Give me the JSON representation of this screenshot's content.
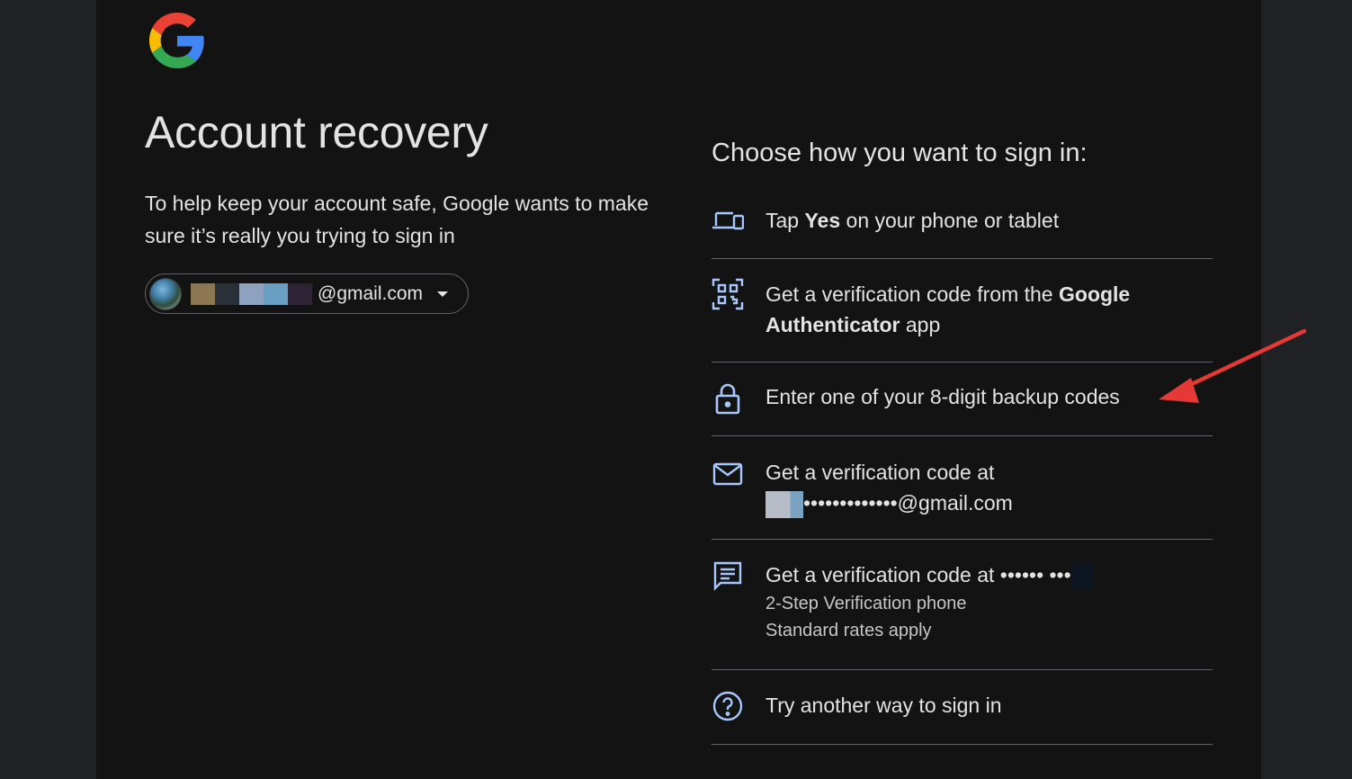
{
  "header": {
    "logo": "google-g-logo"
  },
  "left": {
    "title": "Account recovery",
    "subtitle": "To help keep your account safe, Google wants to make sure it’s really you trying to sign in",
    "account_email_suffix": "@gmail.com"
  },
  "right": {
    "choose_label": "Choose how you want to sign in:",
    "options": [
      {
        "icon": "devices-icon",
        "pre": "Tap ",
        "bold": "Yes",
        "post": " on your phone or tablet"
      },
      {
        "icon": "qr-code-icon",
        "pre": "Get a verification code from the ",
        "bold": "Google Authenticator",
        "post": " app"
      },
      {
        "icon": "lock-icon",
        "text": "Enter one of your 8-digit backup codes"
      },
      {
        "icon": "mail-icon",
        "line1": "Get a verification code at",
        "line2_suffix": "•••••••••••••@gmail.com"
      },
      {
        "icon": "message-icon",
        "line1": "Get a verification code at •••••• •••",
        "sub1": "2-Step Verification phone",
        "sub2": "Standard rates apply"
      },
      {
        "icon": "help-icon",
        "text": "Try another way to sign in"
      }
    ]
  },
  "colors": {
    "accent_icon": "#a8c7fa",
    "annotation_arrow": "#e53935",
    "divider": "#5f6368",
    "card_bg": "#131314"
  }
}
